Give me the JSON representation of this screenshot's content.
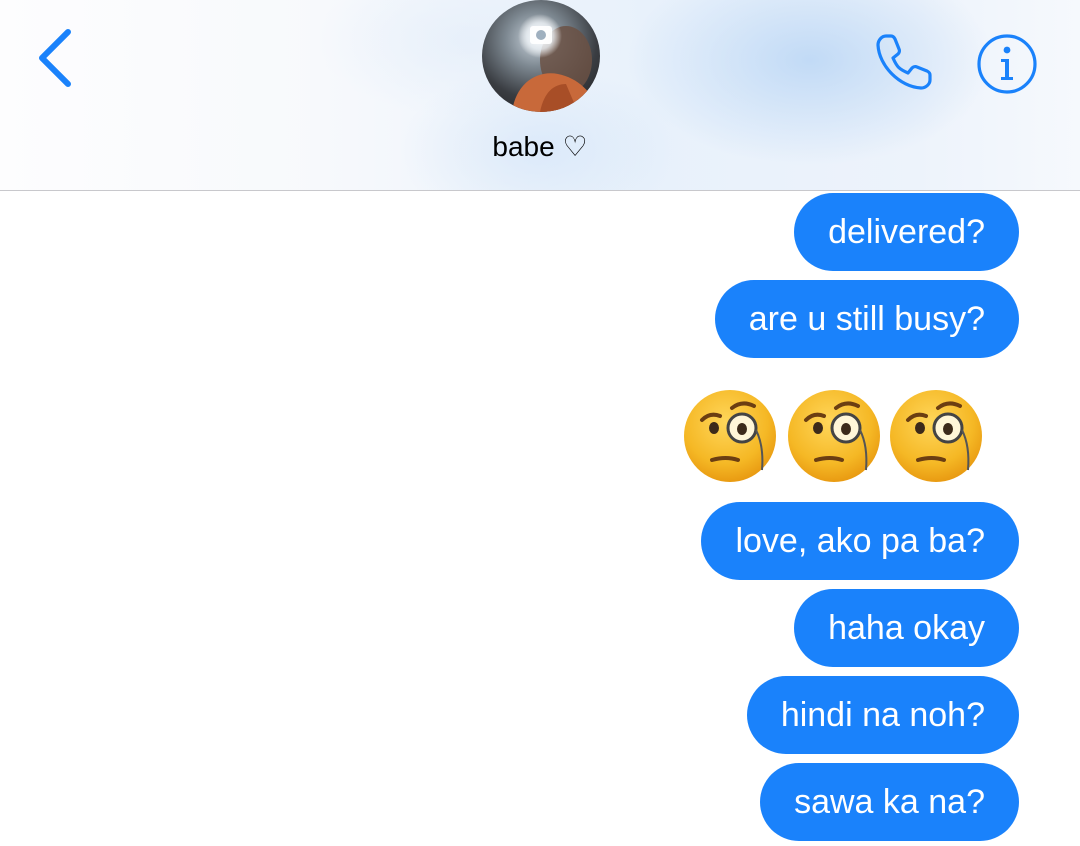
{
  "header": {
    "contact_name": "babe ♡",
    "back_icon": "chevron-left-icon",
    "call_icon": "phone-icon",
    "info_icon": "info-icon"
  },
  "thread": {
    "messages": [
      {
        "text": "delivered?",
        "sender": "me"
      },
      {
        "text": "are u still busy?",
        "sender": "me"
      },
      {
        "emoji": [
          "face-with-monocle",
          "face-with-monocle",
          "face-with-monocle"
        ],
        "sender": "me"
      },
      {
        "text": "love, ako pa ba?",
        "sender": "me"
      },
      {
        "text": "haha okay",
        "sender": "me"
      },
      {
        "text": "hindi na noh?",
        "sender": "me"
      },
      {
        "text": "sawa ka na?",
        "sender": "me"
      }
    ]
  },
  "colors": {
    "accent": "#1a82fb",
    "bubble_text": "#ffffff",
    "emoji_yellow": "#f5b825"
  }
}
